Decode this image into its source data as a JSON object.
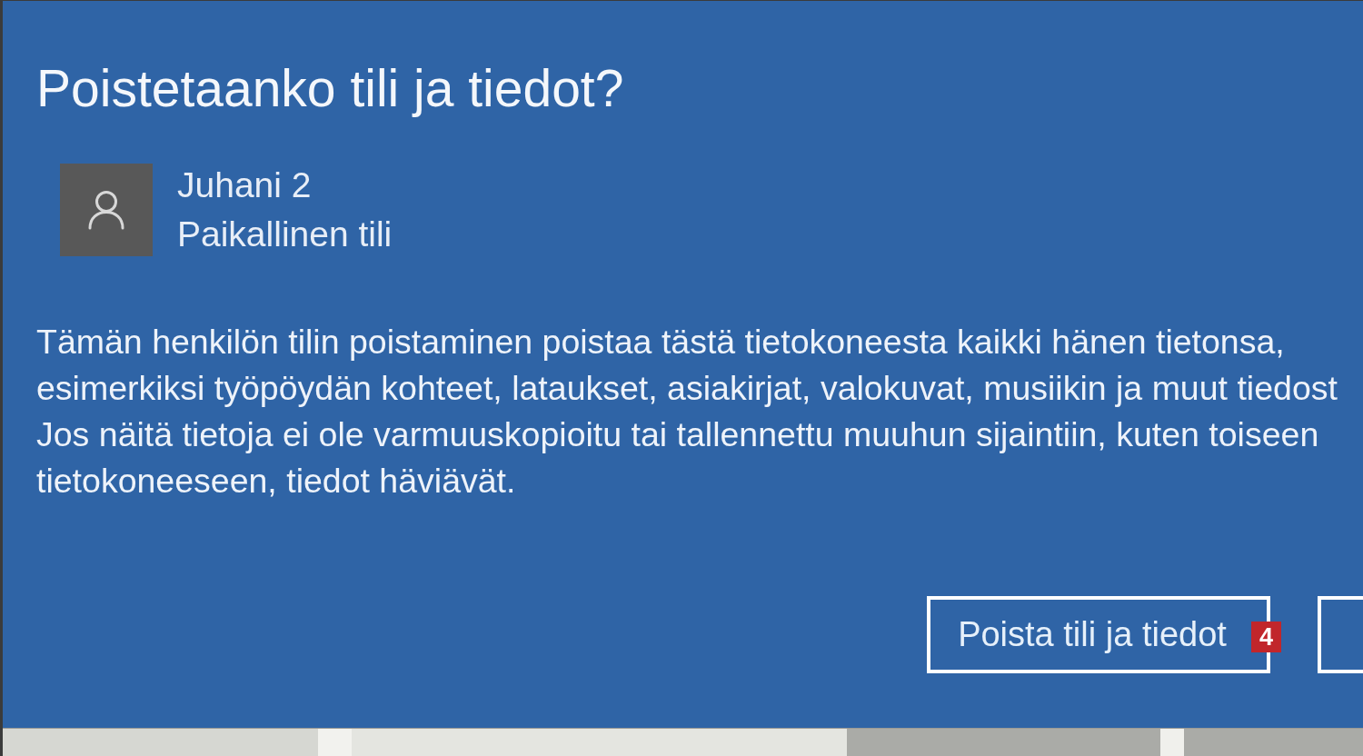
{
  "dialog": {
    "title": "Poistetaanko tili ja tiedot?",
    "account": {
      "name": "Juhani 2",
      "type": "Paikallinen tili"
    },
    "message_lines": [
      "Tämän henkilön tilin poistaminen poistaa tästä tietokoneesta kaikki hänen tietonsa,",
      "esimerkiksi työpöydän kohteet, lataukset, asiakirjat, valokuvat, musiikin ja muut tiedost",
      "Jos näitä tietoja ei ole varmuuskopioitu tai tallennettu muuhun sijaintiin, kuten toiseen",
      "tietokoneeseen, tiedot häviävät."
    ],
    "buttons": [
      {
        "kind": "full",
        "label": "Poista tili ja tiedot",
        "marker": "4"
      },
      {
        "kind": "cut-off"
      }
    ]
  }
}
